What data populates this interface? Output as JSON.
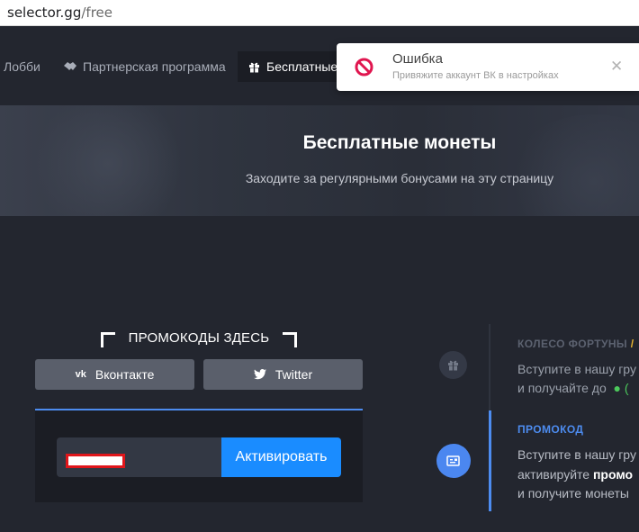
{
  "browser": {
    "url_host": "selector.gg",
    "url_path": "/free"
  },
  "nav": {
    "lobby": "Лобби",
    "partner": "Партнерская программа",
    "free": "Бесплатные"
  },
  "hero": {
    "title": "Бесплатные монеты",
    "subtitle": "Заходите за регулярными бонусами на эту страницу"
  },
  "promo": {
    "heading": "ПРОМОКОДЫ ЗДЕСЬ",
    "vk_label": "Вконтакте",
    "vk_icon_text": "vk",
    "twitter_label": "Twitter",
    "input_value": "",
    "activate_label": "Активировать"
  },
  "side": {
    "wheel_title": "КОЛЕСО ФОРТУНЫ",
    "wheel_title_accent": "/",
    "wheel_line1": "Вступите в нашу гру",
    "wheel_line2": "и получайте до",
    "wheel_line2_tail": "(",
    "promo_title": "ПРОМОКОД",
    "promo_line1": "Вступите в нашу гру",
    "promo_line2_a": "активируйте",
    "promo_line2_b": "промо",
    "promo_line3": "и получите монеты"
  },
  "toast": {
    "title": "Ошибка",
    "message": "Привяжите аккаунт ВК в настройках",
    "close": "✕"
  },
  "colors": {
    "accent_blue": "#1a8cff",
    "error_red": "#e0164f",
    "gold": "#e8b630"
  }
}
